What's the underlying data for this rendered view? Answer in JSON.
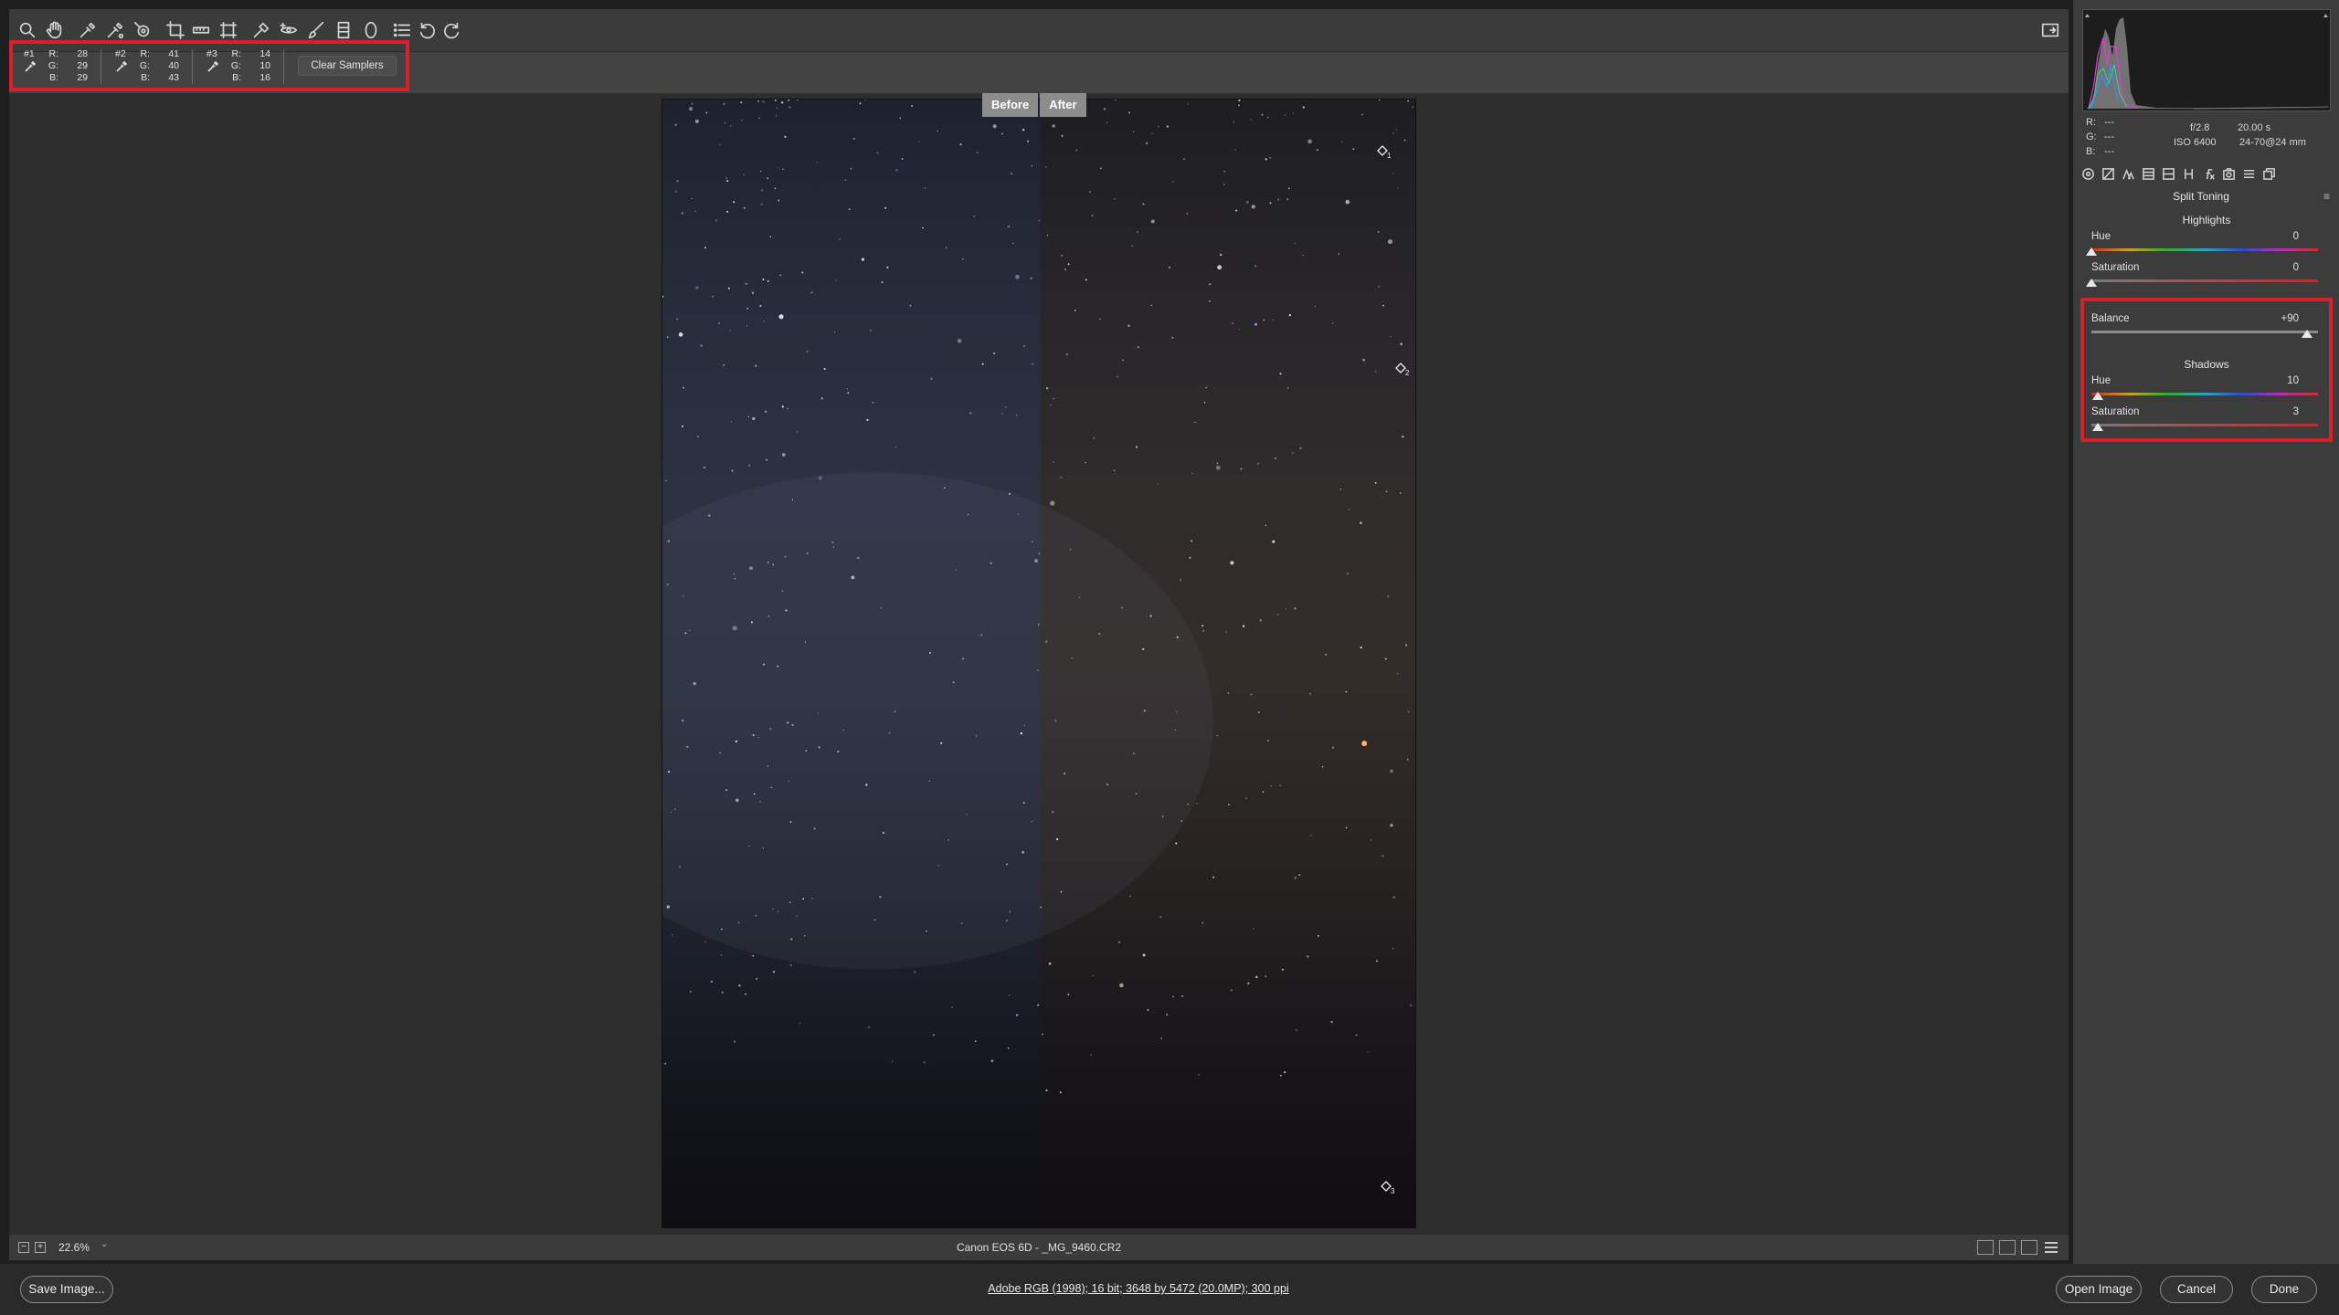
{
  "toolbar": {
    "tools": [
      "zoom-icon",
      "hand-icon",
      "white-balance-icon",
      "color-sampler-icon",
      "targeted-adjustment-icon",
      "crop-icon",
      "straighten-icon",
      "transform-icon",
      "spot-removal-icon",
      "red-eye-icon",
      "adjustment-brush-icon",
      "graduated-filter-icon",
      "radial-filter-icon",
      "presets-list-icon",
      "rotate-left-icon",
      "rotate-right-icon"
    ]
  },
  "samplers": [
    {
      "num": "#1",
      "r_label": "R:",
      "g_label": "G:",
      "b_label": "B:",
      "r": "28",
      "g": "29",
      "b": "29"
    },
    {
      "num": "#2",
      "r_label": "R:",
      "g_label": "G:",
      "b_label": "B:",
      "r": "41",
      "g": "40",
      "b": "43"
    },
    {
      "num": "#3",
      "r_label": "R:",
      "g_label": "G:",
      "b_label": "B:",
      "r": "14",
      "g": "10",
      "b": "16"
    }
  ],
  "clear_samplers_label": "Clear Samplers",
  "before_after": {
    "before": "Before",
    "after": "After"
  },
  "sampler_markers": [
    "1",
    "2",
    "3"
  ],
  "status": {
    "zoom": "22.6%",
    "zoom_out": "−",
    "zoom_in": "+",
    "dropdown": "⌄",
    "file": "Canon EOS 6D  -  _MG_9460.CR2"
  },
  "footer": {
    "save": "Save Image...",
    "workflow": "Adobe RGB (1998); 16 bit; 3648 by 5472 (20.0MP); 300 ppi",
    "open": "Open Image",
    "cancel": "Cancel",
    "done": "Done"
  },
  "info": {
    "r_label": "R:",
    "g_label": "G:",
    "b_label": "B:",
    "r": "---",
    "g": "---",
    "b": "---",
    "aperture": "f/2.8",
    "shutter": "20.00 s",
    "iso": "ISO 6400",
    "lens": "24-70@24 mm"
  },
  "panel": {
    "title": "Split Toning",
    "menu": "≡",
    "highlights": {
      "header": "Highlights",
      "hue_label": "Hue",
      "hue_value": "0",
      "hue_level": 0,
      "sat_label": "Saturation",
      "sat_value": "0",
      "sat_level": 0
    },
    "balance": {
      "label": "Balance",
      "value": "+90",
      "level": 0.95
    },
    "shadows": {
      "header": "Shadows",
      "hue_label": "Hue",
      "hue_value": "10",
      "hue_level": 0.028,
      "sat_label": "Saturation",
      "sat_value": "3",
      "sat_level": 0.03
    }
  },
  "colors": {
    "highlight_box": "#d8202a",
    "panel_bg": "#3c3c3c",
    "canvas_bg": "#2d2d2d"
  }
}
